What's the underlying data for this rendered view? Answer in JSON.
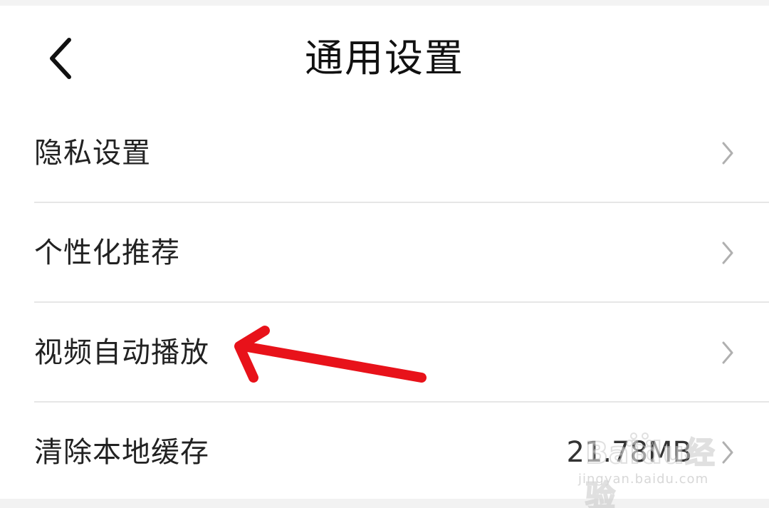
{
  "header": {
    "title": "通用设置",
    "back_icon": "chevron-left-icon"
  },
  "settings": {
    "items": [
      {
        "label": "隐私设置",
        "value": ""
      },
      {
        "label": "个性化推荐",
        "value": ""
      },
      {
        "label": "视频自动播放",
        "value": ""
      },
      {
        "label": "清除本地缓存",
        "value": "21.78MB"
      }
    ]
  },
  "annotation": {
    "arrow_color": "#e8121a"
  },
  "watermark": {
    "brand": "Baidu经验",
    "url": "jingyan.baidu.com"
  },
  "colors": {
    "background": "#ffffff",
    "divider": "#e6e6e6",
    "chevron": "#b0b0b0",
    "text": "#222222"
  }
}
